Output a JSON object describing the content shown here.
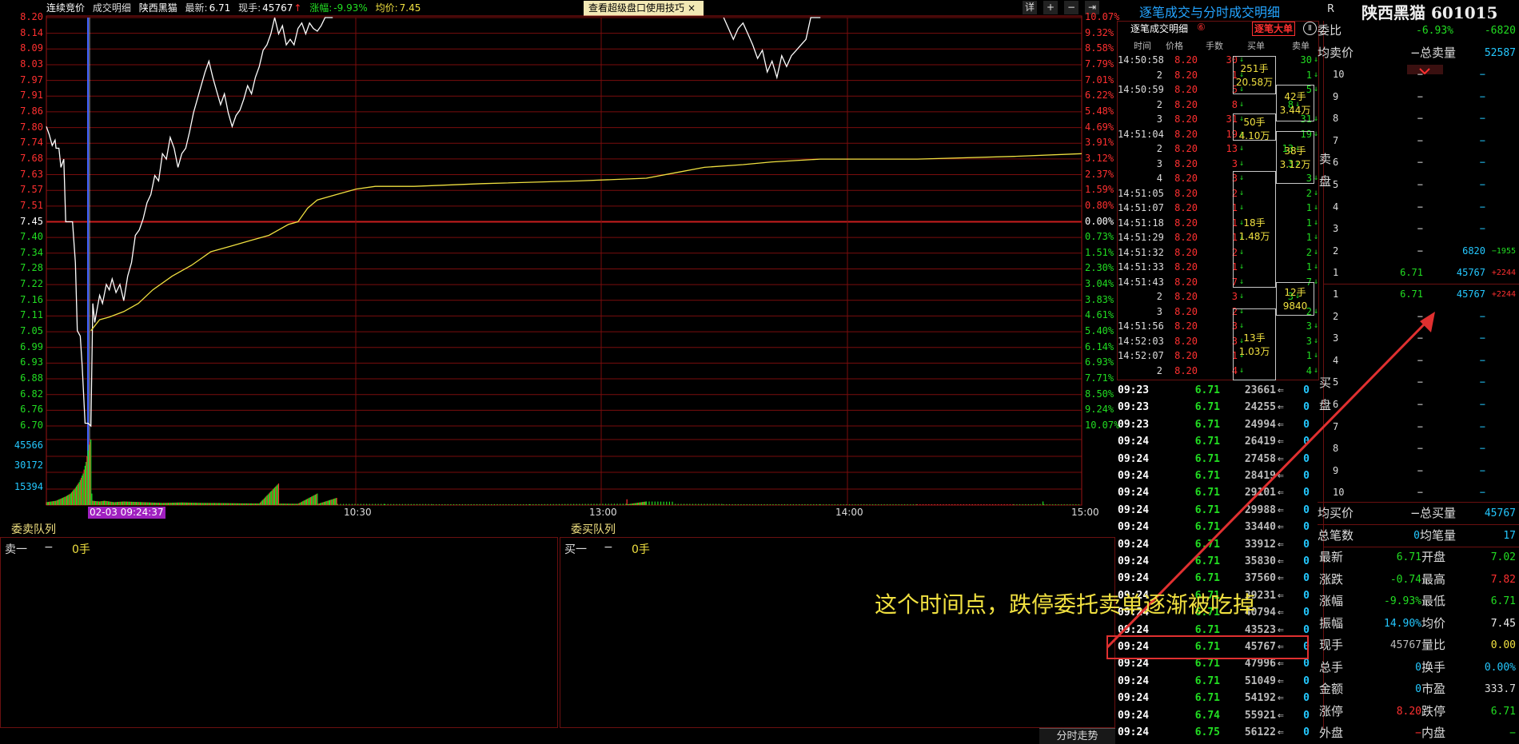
{
  "header": {
    "auction_label": "连续竞价",
    "detail_label": "成交明细",
    "stock_name": "陕西黑猫",
    "latest_label": "最新:",
    "latest_value": "6.71",
    "volume_label": "现手:",
    "volume_value": "45767",
    "change_label": "涨幅:",
    "change_value": "-9.93%",
    "avg_label": "均价:",
    "avg_value": "7.45",
    "tip_text": "查看超级盘口使用技巧",
    "tip_close": "×",
    "ctrl_detail": "详",
    "ctrl_plus": "+",
    "ctrl_minus": "−",
    "ctrl_end": "⇥"
  },
  "chart_data": {
    "type": "line",
    "title": "",
    "date_time_cursor": "02-03 09:24:37",
    "y_prices": [
      "8.20",
      "8.14",
      "8.09",
      "8.03",
      "7.97",
      "7.91",
      "7.86",
      "7.80",
      "7.74",
      "7.68",
      "7.63",
      "7.57",
      "7.51",
      "7.45",
      "7.40",
      "7.34",
      "7.28",
      "7.22",
      "7.16",
      "7.11",
      "7.05",
      "6.99",
      "6.93",
      "6.88",
      "6.82",
      "6.76",
      "6.70"
    ],
    "y_pcts": [
      "10.07%",
      "9.32%",
      "8.58%",
      "7.79%",
      "7.01%",
      "6.22%",
      "5.48%",
      "4.69%",
      "3.91%",
      "3.12%",
      "2.37%",
      "1.59%",
      "0.80%",
      "0.00%",
      "0.73%",
      "1.51%",
      "2.30%",
      "3.04%",
      "3.83%",
      "4.61%",
      "5.40%",
      "6.14%",
      "6.93%",
      "7.71%",
      "8.50%",
      "9.24%",
      "10.07%"
    ],
    "volume_ticks": [
      "45566",
      "30172",
      "15394"
    ],
    "x_ticks": [
      "10:30",
      "13:00",
      "14:00",
      "15:00"
    ],
    "ylim": [
      6.7,
      8.2
    ],
    "prev_close": 7.45,
    "price_series": [
      [
        0,
        7.8
      ],
      [
        3,
        7.77
      ],
      [
        6,
        7.73
      ],
      [
        9,
        7.75
      ],
      [
        10,
        7.72
      ],
      [
        13,
        7.72
      ],
      [
        15,
        7.65
      ],
      [
        18,
        7.68
      ],
      [
        20,
        7.45
      ],
      [
        22,
        7.45
      ],
      [
        25,
        7.45
      ],
      [
        27,
        7.45
      ],
      [
        30,
        7.3
      ],
      [
        32,
        7.05
      ],
      [
        35,
        7.03
      ],
      [
        37,
        6.92
      ],
      [
        40,
        6.71
      ],
      [
        43,
        6.71
      ],
      [
        46,
        6.7
      ],
      [
        48,
        7.15
      ],
      [
        50,
        7.08
      ],
      [
        52,
        7.12
      ],
      [
        55,
        7.18
      ],
      [
        58,
        7.15
      ],
      [
        62,
        7.22
      ],
      [
        65,
        7.2
      ],
      [
        68,
        7.24
      ],
      [
        72,
        7.19
      ],
      [
        76,
        7.22
      ],
      [
        80,
        7.16
      ],
      [
        84,
        7.25
      ],
      [
        88,
        7.3
      ],
      [
        92,
        7.4
      ],
      [
        96,
        7.42
      ],
      [
        100,
        7.46
      ],
      [
        104,
        7.52
      ],
      [
        108,
        7.55
      ],
      [
        112,
        7.62
      ],
      [
        116,
        7.6
      ],
      [
        120,
        7.7
      ],
      [
        124,
        7.68
      ],
      [
        128,
        7.76
      ],
      [
        132,
        7.72
      ],
      [
        136,
        7.65
      ],
      [
        140,
        7.7
      ],
      [
        144,
        7.72
      ],
      [
        148,
        7.78
      ],
      [
        152,
        7.85
      ],
      [
        156,
        7.9
      ],
      [
        160,
        7.95
      ],
      [
        164,
        8.0
      ],
      [
        168,
        8.04
      ],
      [
        172,
        7.98
      ],
      [
        176,
        7.93
      ],
      [
        180,
        7.88
      ],
      [
        184,
        7.92
      ],
      [
        188,
        7.85
      ],
      [
        192,
        7.8
      ],
      [
        196,
        7.84
      ],
      [
        200,
        7.86
      ],
      [
        204,
        7.9
      ],
      [
        208,
        7.95
      ],
      [
        212,
        7.92
      ],
      [
        216,
        7.98
      ],
      [
        220,
        8.02
      ],
      [
        224,
        8.08
      ],
      [
        228,
        8.1
      ],
      [
        232,
        8.14
      ],
      [
        236,
        8.2
      ],
      [
        240,
        8.14
      ],
      [
        244,
        8.17
      ],
      [
        248,
        8.1
      ],
      [
        252,
        8.12
      ],
      [
        256,
        8.1
      ],
      [
        260,
        8.16
      ],
      [
        264,
        8.18
      ],
      [
        268,
        8.14
      ],
      [
        272,
        8.18
      ],
      [
        276,
        8.16
      ],
      [
        280,
        8.15
      ],
      [
        284,
        8.17
      ],
      [
        288,
        8.2
      ],
      [
        292,
        8.2
      ],
      [
        296,
        8.2
      ],
      [
        700,
        8.2
      ],
      [
        710,
        8.12
      ],
      [
        715,
        8.16
      ],
      [
        720,
        8.18
      ],
      [
        725,
        8.14
      ],
      [
        730,
        8.1
      ],
      [
        735,
        8.05
      ],
      [
        740,
        8.08
      ],
      [
        745,
        8.0
      ],
      [
        750,
        8.04
      ],
      [
        755,
        7.98
      ],
      [
        760,
        8.06
      ],
      [
        765,
        8.02
      ],
      [
        770,
        8.06
      ],
      [
        775,
        8.08
      ],
      [
        780,
        8.1
      ],
      [
        785,
        8.12
      ],
      [
        790,
        8.2
      ],
      [
        800,
        8.2
      ],
      [
        1070,
        8.2
      ]
    ],
    "avg_series": [
      [
        46,
        7.05
      ],
      [
        55,
        7.09
      ],
      [
        65,
        7.1
      ],
      [
        80,
        7.12
      ],
      [
        95,
        7.15
      ],
      [
        110,
        7.2
      ],
      [
        130,
        7.25
      ],
      [
        150,
        7.29
      ],
      [
        170,
        7.34
      ],
      [
        190,
        7.36
      ],
      [
        210,
        7.38
      ],
      [
        230,
        7.4
      ],
      [
        240,
        7.42
      ],
      [
        250,
        7.44
      ],
      [
        260,
        7.45
      ],
      [
        270,
        7.5
      ],
      [
        280,
        7.53
      ],
      [
        300,
        7.55
      ],
      [
        320,
        7.57
      ],
      [
        340,
        7.58
      ],
      [
        380,
        7.58
      ],
      [
        450,
        7.59
      ],
      [
        550,
        7.6
      ],
      [
        620,
        7.61
      ],
      [
        650,
        7.63
      ],
      [
        680,
        7.65
      ],
      [
        720,
        7.66
      ],
      [
        750,
        7.67
      ],
      [
        800,
        7.68
      ],
      [
        900,
        7.68
      ],
      [
        1000,
        7.69
      ],
      [
        1070,
        7.7
      ]
    ],
    "volume_series": [
      [
        0,
        2000
      ],
      [
        10,
        3000
      ],
      [
        20,
        6000
      ],
      [
        25,
        8000
      ],
      [
        30,
        12000
      ],
      [
        34,
        16000
      ],
      [
        38,
        22000
      ],
      [
        41,
        30000
      ],
      [
        44,
        42000
      ],
      [
        46,
        45566
      ],
      [
        47,
        8000
      ],
      [
        48,
        3000
      ],
      [
        55,
        2500
      ],
      [
        60,
        3000
      ],
      [
        70,
        2000
      ],
      [
        80,
        2500
      ],
      [
        100,
        2000
      ],
      [
        120,
        1500
      ],
      [
        140,
        1800
      ],
      [
        160,
        1500
      ],
      [
        180,
        1400
      ],
      [
        200,
        1200
      ],
      [
        220,
        1100
      ],
      [
        240,
        15000
      ],
      [
        241,
        1000
      ],
      [
        260,
        900
      ],
      [
        280,
        8000
      ],
      [
        281,
        900
      ],
      [
        300,
        5000
      ],
      [
        301,
        800
      ],
      [
        350,
        700
      ],
      [
        400,
        600
      ],
      [
        500,
        600
      ],
      [
        600,
        4000
      ],
      [
        601,
        600
      ],
      [
        620,
        2500
      ],
      [
        650,
        800
      ],
      [
        700,
        600
      ],
      [
        800,
        500
      ],
      [
        900,
        500
      ],
      [
        1000,
        500
      ],
      [
        1030,
        2500
      ],
      [
        1031,
        500
      ],
      [
        1070,
        500
      ]
    ]
  },
  "queues": {
    "sell_title": "委卖队列",
    "buy_title": "委买队列",
    "sell_label": "卖一",
    "sell_dash": "−",
    "sell_qty": "0手",
    "buy_label": "买一",
    "buy_dash": "−",
    "buy_qty": "0手"
  },
  "right": {
    "title_a": "逐笔成交与分时成交明细",
    "title_r": "R",
    "title_b": "陕西黑猫 601015",
    "sub_title": "逐笔成交明细",
    "sub_circle": "⑥",
    "big_btn": "逐笔大单",
    "pause": "Ⅱ",
    "cols": [
      "时间",
      "价格",
      "手数",
      "买单",
      "卖单"
    ],
    "ticks": [
      {
        "t": "14:50:58",
        "p": "8.20",
        "q": "30",
        "b": "",
        "s": "30"
      },
      {
        "t": "2",
        "p": "8.20",
        "q": "1",
        "b": "",
        "s": "1"
      },
      {
        "t": "14:50:59",
        "p": "8.20",
        "q": "5",
        "b": "",
        "s": "5"
      },
      {
        "t": "2",
        "p": "8.20",
        "q": "8",
        "b": "8",
        "s": ""
      },
      {
        "t": "3",
        "p": "8.20",
        "q": "31",
        "b": "",
        "s": "31"
      },
      {
        "t": "14:51:04",
        "p": "8.20",
        "q": "19",
        "b": "",
        "s": "19"
      },
      {
        "t": "2",
        "p": "8.20",
        "q": "13",
        "b": "13",
        "s": ""
      },
      {
        "t": "3",
        "p": "8.20",
        "q": "3",
        "b": "3",
        "s": ""
      },
      {
        "t": "4",
        "p": "8.20",
        "q": "3",
        "b": "",
        "s": "3"
      },
      {
        "t": "14:51:05",
        "p": "8.20",
        "q": "2",
        "b": "",
        "s": "2"
      },
      {
        "t": "14:51:07",
        "p": "8.20",
        "q": "1",
        "b": "",
        "s": "1"
      },
      {
        "t": "14:51:18",
        "p": "8.20",
        "q": "1",
        "b": "",
        "s": "1"
      },
      {
        "t": "14:51:29",
        "p": "8.20",
        "q": "1",
        "b": "",
        "s": "1"
      },
      {
        "t": "14:51:32",
        "p": "8.20",
        "q": "2",
        "b": "",
        "s": "2"
      },
      {
        "t": "14:51:33",
        "p": "8.20",
        "q": "1",
        "b": "",
        "s": "1"
      },
      {
        "t": "14:51:43",
        "p": "8.20",
        "q": "7",
        "b": "",
        "s": "7"
      },
      {
        "t": "2",
        "p": "8.20",
        "q": "3",
        "b": "3",
        "s": ""
      },
      {
        "t": "3",
        "p": "8.20",
        "q": "2",
        "b": "",
        "s": "2"
      },
      {
        "t": "14:51:56",
        "p": "8.20",
        "q": "3",
        "b": "",
        "s": "3"
      },
      {
        "t": "14:52:03",
        "p": "8.20",
        "q": "3",
        "b": "",
        "s": "3"
      },
      {
        "t": "14:52:07",
        "p": "8.20",
        "q": "1",
        "b": "",
        "s": "1"
      },
      {
        "t": "2",
        "p": "8.20",
        "q": "4",
        "b": "",
        "s": "4"
      }
    ],
    "blocks": [
      {
        "a": "251手",
        "b": "20.58万"
      },
      {
        "a": "42手",
        "b": "3.44万"
      },
      {
        "a": "50手",
        "b": "4.10万"
      },
      {
        "a": "38手",
        "b": "3.12万"
      },
      {
        "a": "18手",
        "b": "1.48万"
      },
      {
        "a": "12手",
        "b": "9840"
      },
      {
        "a": "13手",
        "b": "1.03万"
      }
    ],
    "ticks2": [
      {
        "t": "09:23",
        "p": "6.71",
        "q": "23661",
        "z": "0"
      },
      {
        "t": "09:23",
        "p": "6.71",
        "q": "24255",
        "z": "0"
      },
      {
        "t": "09:23",
        "p": "6.71",
        "q": "24994",
        "z": "0"
      },
      {
        "t": "09:24",
        "p": "6.71",
        "q": "26419",
        "z": "0"
      },
      {
        "t": "09:24",
        "p": "6.71",
        "q": "27458",
        "z": "0"
      },
      {
        "t": "09:24",
        "p": "6.71",
        "q": "28419",
        "z": "0"
      },
      {
        "t": "09:24",
        "p": "6.71",
        "q": "29101",
        "z": "0"
      },
      {
        "t": "09:24",
        "p": "6.71",
        "q": "29988",
        "z": "0"
      },
      {
        "t": "09:24",
        "p": "6.71",
        "q": "33440",
        "z": "0"
      },
      {
        "t": "09:24",
        "p": "6.71",
        "q": "33912",
        "z": "0"
      },
      {
        "t": "09:24",
        "p": "6.71",
        "q": "35830",
        "z": "0"
      },
      {
        "t": "09:24",
        "p": "6.71",
        "q": "37560",
        "z": "0"
      },
      {
        "t": "09:24",
        "p": "6.71",
        "q": "39231",
        "z": "0"
      },
      {
        "t": "09:24",
        "p": "6.71",
        "q": "40794",
        "z": "0"
      },
      {
        "t": "09:24",
        "p": "6.71",
        "q": "43523",
        "z": "0"
      },
      {
        "t": "09:24",
        "p": "6.71",
        "q": "45767",
        "z": "0"
      },
      {
        "t": "09:24",
        "p": "6.71",
        "q": "47996",
        "z": "0"
      },
      {
        "t": "09:24",
        "p": "6.71",
        "q": "51049",
        "z": "0"
      },
      {
        "t": "09:24",
        "p": "6.71",
        "q": "54192",
        "z": "0"
      },
      {
        "t": "09:24",
        "p": "6.74",
        "q": "55921",
        "z": "0"
      },
      {
        "t": "09:24",
        "p": "6.75",
        "q": "56122",
        "z": "0"
      }
    ],
    "committee": {
      "l1": "委比",
      "v1": "-6.93%",
      "v2": "-6820"
    },
    "sell_head": {
      "l1": "均卖价",
      "dash": "−",
      "l2": "总卖量",
      "v": "52587"
    },
    "sell_rows": [
      {
        "n": "10",
        "p": "−",
        "q": "−",
        "c": ""
      },
      {
        "n": "9",
        "p": "−",
        "q": "−",
        "c": ""
      },
      {
        "n": "8",
        "p": "−",
        "q": "−",
        "c": ""
      },
      {
        "n": "7",
        "p": "−",
        "q": "−",
        "c": ""
      },
      {
        "n": "6",
        "p": "−",
        "q": "−",
        "c": ""
      },
      {
        "n": "5",
        "p": "−",
        "q": "−",
        "c": ""
      },
      {
        "n": "4",
        "p": "−",
        "q": "−",
        "c": ""
      },
      {
        "n": "3",
        "p": "−",
        "q": "−",
        "c": ""
      },
      {
        "n": "2",
        "p": "−",
        "q": "6820",
        "c": "−1955"
      },
      {
        "n": "1",
        "p": "6.71",
        "q": "45767",
        "c": "+2244"
      }
    ],
    "buy_rows": [
      {
        "n": "1",
        "p": "6.71",
        "q": "45767",
        "c": "+2244"
      },
      {
        "n": "2",
        "p": "−",
        "q": "−",
        "c": ""
      },
      {
        "n": "3",
        "p": "−",
        "q": "−",
        "c": ""
      },
      {
        "n": "4",
        "p": "−",
        "q": "−",
        "c": ""
      },
      {
        "n": "5",
        "p": "−",
        "q": "−",
        "c": ""
      },
      {
        "n": "6",
        "p": "−",
        "q": "−",
        "c": ""
      },
      {
        "n": "7",
        "p": "−",
        "q": "−",
        "c": ""
      },
      {
        "n": "8",
        "p": "−",
        "q": "−",
        "c": ""
      },
      {
        "n": "9",
        "p": "−",
        "q": "−",
        "c": ""
      },
      {
        "n": "10",
        "p": "−",
        "q": "−",
        "c": ""
      }
    ],
    "side_sell": [
      "卖",
      "盘"
    ],
    "side_buy": [
      "买",
      "盘"
    ],
    "buy_head": {
      "l1": "均买价",
      "dash": "−",
      "l2": "总买量",
      "v": "45767"
    },
    "total": {
      "l1": "总笔数",
      "v1": "0",
      "l2": "均笔量",
      "v2": "17"
    },
    "stats": [
      {
        "l1": "最新",
        "v1": "6.71",
        "c1": "#22dd22",
        "l2": "开盘",
        "v2": "7.02",
        "c2": "#22dd22"
      },
      {
        "l1": "涨跌",
        "v1": "-0.74",
        "c1": "#22dd22",
        "l2": "最高",
        "v2": "7.82",
        "c2": "#ff3030"
      },
      {
        "l1": "涨幅",
        "v1": "-9.93%",
        "c1": "#22dd22",
        "l2": "最低",
        "v2": "6.71",
        "c2": "#22dd22"
      },
      {
        "l1": "振幅",
        "v1": "14.90%",
        "c1": "#24c8ff",
        "l2": "均价",
        "v2": "7.45",
        "c2": "#eeeeee"
      },
      {
        "l1": "现手",
        "v1": "45767",
        "c1": "#bbbbbb",
        "l2": "量比",
        "v2": "0.00",
        "c2": "#f0e040"
      },
      {
        "l1": "总手",
        "v1": "0",
        "c1": "#24c8ff",
        "l2": "换手",
        "v2": "0.00%",
        "c2": "#24c8ff"
      },
      {
        "l1": "金额",
        "v1": "0",
        "c1": "#24c8ff",
        "l2": "市盈",
        "v2": "333.7",
        "c2": "#dddddd"
      },
      {
        "l1": "涨停",
        "v1": "8.20",
        "c1": "#ff3030",
        "l2": "跌停",
        "v2": "6.71",
        "c2": "#22dd22"
      },
      {
        "l1": "外盘",
        "v1": "−",
        "c1": "#ff3030",
        "l2": "内盘",
        "v2": "−",
        "c2": "#22dd22"
      }
    ]
  },
  "annotation": "这个时间点，跌停委托卖单逐渐被吃掉",
  "bottom_tab": "分时走势",
  "colors": {
    "up": "#ff3030",
    "down": "#22dd22",
    "avg": "#f0e040",
    "accent": "#24a4ff"
  }
}
